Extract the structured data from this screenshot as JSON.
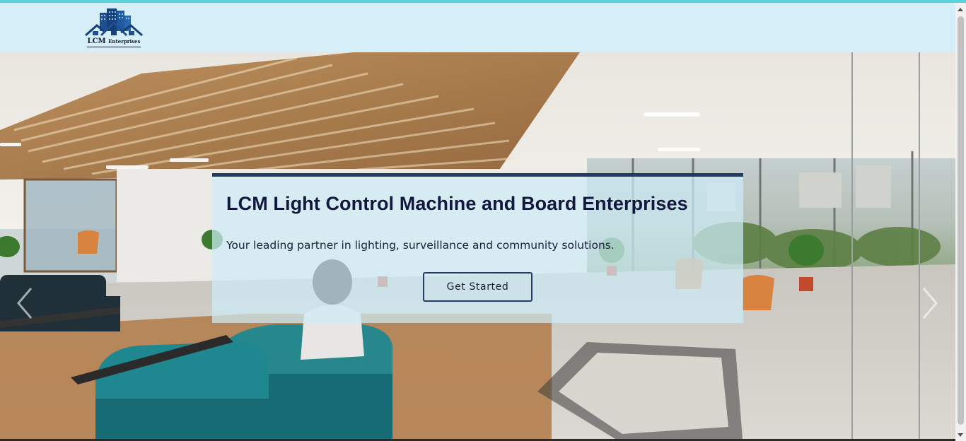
{
  "header": {
    "logo_text": "LCM",
    "logo_subtext": "Enterprises"
  },
  "hero": {
    "title": "LCM Light Control Machine and Board Enterprises",
    "subtitle": "Your leading partner in lighting, surveillance and community solutions.",
    "cta_label": "Get Started",
    "prev_icon": "chevron-left-icon",
    "next_icon": "chevron-right-icon"
  },
  "colors": {
    "header_bg": "#d6eef7",
    "banner_border": "#243b66",
    "title": "#12183d",
    "top_accent": "#5ad4dc"
  }
}
